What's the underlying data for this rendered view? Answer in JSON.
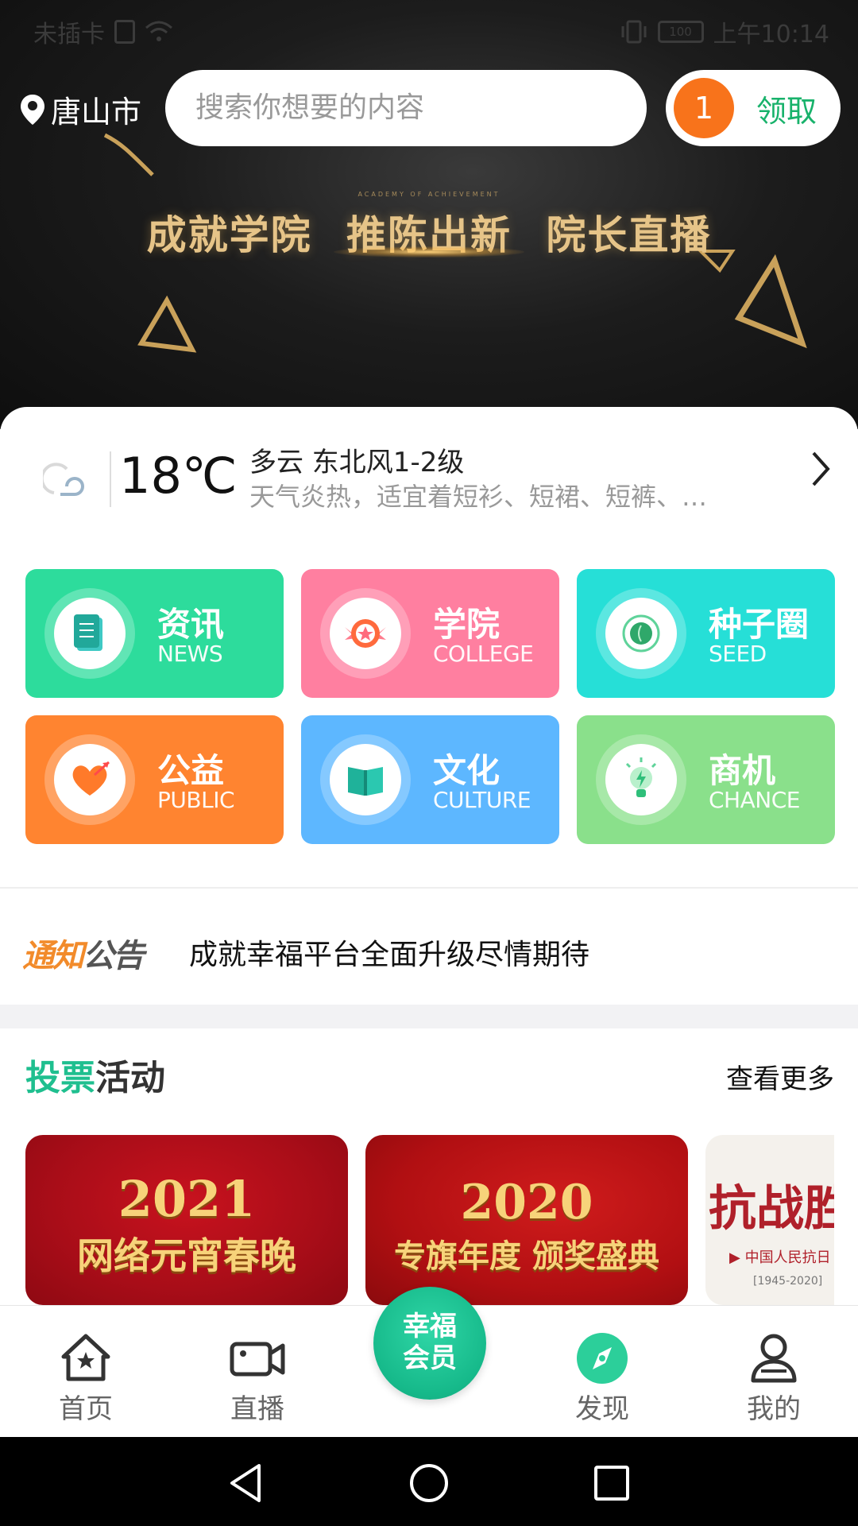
{
  "status_bar": {
    "carrier": "未插卡",
    "battery": "100",
    "time": "上午10:14"
  },
  "header": {
    "city": "唐山市",
    "search_placeholder": "搜索你想要的内容",
    "claim_count": "1",
    "claim_label": "领取"
  },
  "banner": {
    "headline": "成就学院  推陈出新  院长直播",
    "tagline": "ACADEMY OF ACHIEVEMENT"
  },
  "weather": {
    "temperature": "18℃",
    "condition": "多云 东北风1-2级",
    "tip": "天气炎热，适宜着短衫、短裙、短裤、…",
    "icon": "cloud-icon"
  },
  "tiles": [
    {
      "title": "资讯",
      "subtitle": "NEWS",
      "color": "#2ddc9c",
      "icon": "book-icon"
    },
    {
      "title": "学院",
      "subtitle": "COLLEGE",
      "color": "#ff7fa0",
      "icon": "badge-star-icon"
    },
    {
      "title": "种子圈",
      "subtitle": "SEED",
      "color": "#26dfd7",
      "icon": "seed-icon"
    },
    {
      "title": "公益",
      "subtitle": "PUBLIC",
      "color": "#ff8430",
      "icon": "heart-arrow-icon"
    },
    {
      "title": "文化",
      "subtitle": "CULTURE",
      "color": "#5db7ff",
      "icon": "open-book-icon"
    },
    {
      "title": "商机",
      "subtitle": "CHANCE",
      "color": "#8ae08b",
      "icon": "lightbulb-icon"
    }
  ],
  "notice": {
    "tag_part1": "通知",
    "tag_part2": "公告",
    "text": "成就幸福平台全面升级尽情期待"
  },
  "vote": {
    "title_part1": "投票",
    "title_part2": "活动",
    "more": "查看更多",
    "cards": [
      {
        "line1": "2021",
        "line2": "网络元宵春晚"
      },
      {
        "line1": "2020",
        "line2": "专旗年度 颁奖盛典"
      },
      {
        "line1": "抗战胜",
        "line2": "▶ 中国人民抗日",
        "line3": "[1945-2020]"
      }
    ]
  },
  "tabbar": {
    "items": [
      {
        "label": "首页",
        "icon": "home-icon"
      },
      {
        "label": "直播",
        "icon": "video-camera-icon"
      },
      {
        "label": "发现",
        "icon": "compass-icon"
      },
      {
        "label": "我的",
        "icon": "user-icon"
      }
    ],
    "center_line1": "幸福",
    "center_line2": "会员",
    "accent": "#18b98a"
  }
}
